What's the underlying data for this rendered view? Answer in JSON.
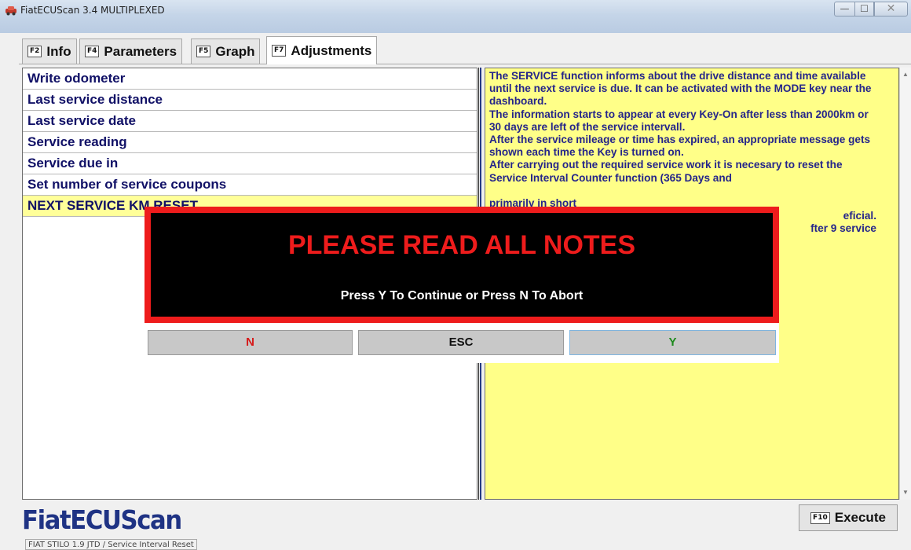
{
  "window": {
    "title": "FiatECUScan 3.4 MULTIPLEXED",
    "minimize_glyph": "—",
    "maximize_glyph": "☐",
    "close_glyph": "✕"
  },
  "tabs": [
    {
      "key": "F2",
      "label": "Info",
      "active": false
    },
    {
      "key": "F4",
      "label": "Parameters",
      "active": false
    },
    {
      "key": "F5",
      "label": "Graph",
      "active": false
    },
    {
      "key": "F7",
      "label": "Adjustments",
      "active": true
    }
  ],
  "adjustments": {
    "items": [
      {
        "label": "Write odometer"
      },
      {
        "label": "Last service distance"
      },
      {
        "label": "Last service date"
      },
      {
        "label": "Service reading"
      },
      {
        "label": "Service due in"
      },
      {
        "label": "Set number of service coupons"
      },
      {
        "label": "NEXT SERVICE KM RESET",
        "selected": true
      }
    ]
  },
  "notes": {
    "text": "The SERVICE function informs about the drive distance and time available until the next service is due. It can be activated with the MODE key near the dashboard.\nThe information starts to appear at every Key-On after less than 2000km or 30 days are left of the service intervall.\nAfter the service mileage or time has expired, an appropriate message gets shown each time the Key is turned on.\nAfter carrying out the required service work it is necesary to reset the Service Interval Counter function (365 Days and\n\nprimarily in short\neficial.\nfter 9 service"
  },
  "modal": {
    "title": "PLEASE READ ALL NOTES",
    "message": "Press Y To Continue or Press N To Abort",
    "buttons": {
      "no": "N",
      "escape": "ESC",
      "yes": "Y"
    }
  },
  "footer": {
    "logo": "FiatECUScan",
    "execute_key": "F10",
    "execute_label": "Execute"
  },
  "status": {
    "text": "FIAT STILO 1.9 JTD / Service Interval Reset"
  },
  "colors": {
    "notes_background": "#ffff88",
    "selected_row": "#ffff99",
    "modal_accent": "#ee1c1c",
    "list_text": "#101066",
    "yes_button_text": "#1d8a1d",
    "no_button_text": "#d61818"
  }
}
